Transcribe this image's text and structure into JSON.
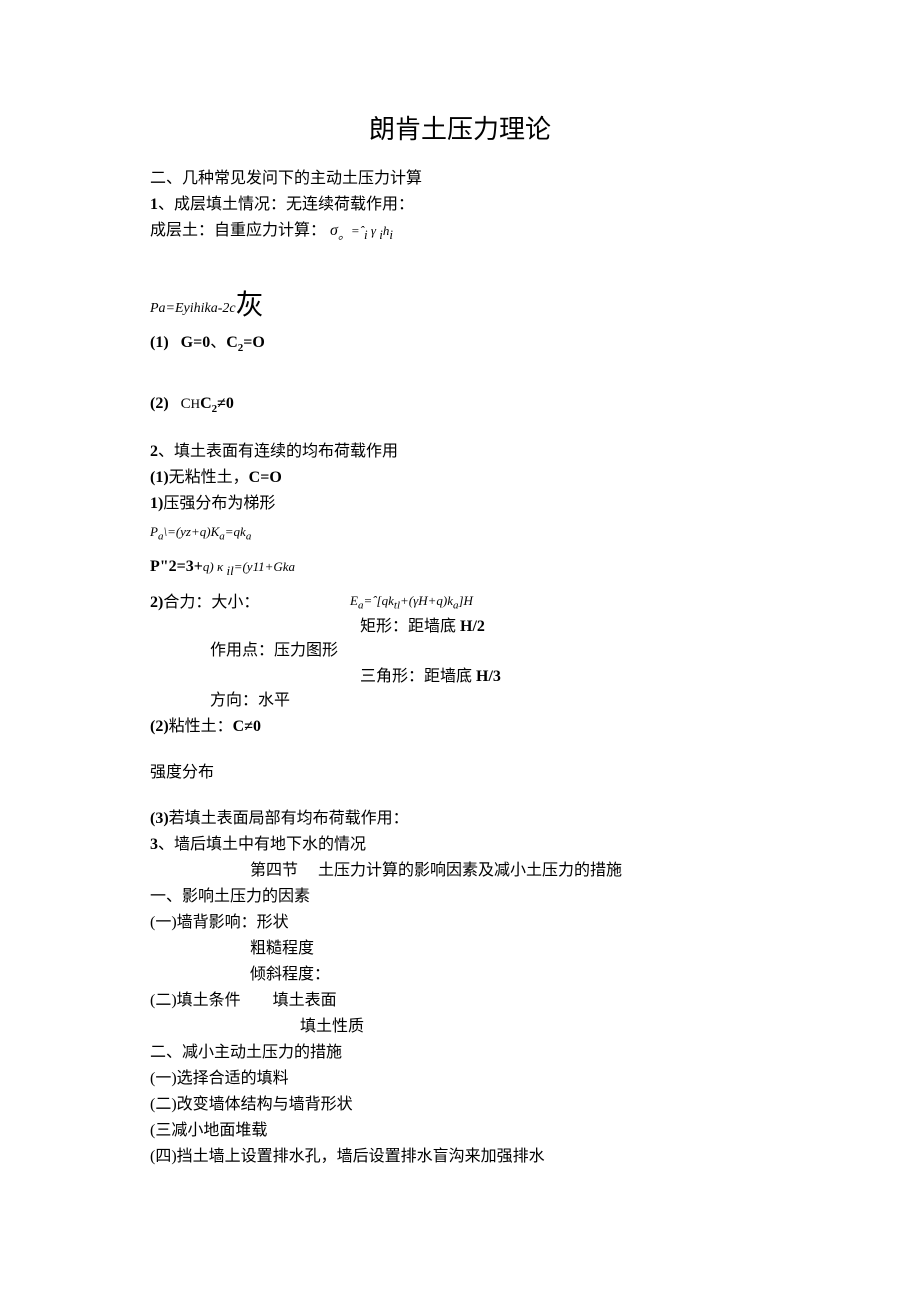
{
  "title": "朗肯土压力理论",
  "p1": "二、几种常见发问下的主动土压力计算",
  "p2a": "1",
  "p2b": "、成层填土情况：无连续荷载作用：",
  "p3a": "成层土：自重应力计算： ",
  "p3b": "σ",
  "p3c": "。",
  "p3d": "=",
  "p3e": "ˆ",
  "p3f": "i",
  "p3g": " γ ",
  "p3h": "i",
  "p3i": "h",
  "p3j": "i",
  "p4a": "Pa=Eyihika-2c",
  "p4b": "灰",
  "p5a": "(1)",
  "p5b": "G=0",
  "p5c": "、",
  "p5d": "C",
  "p5e": "2",
  "p5f": "=O",
  "p6a": "(2)",
  "p6b": "C",
  "p6c": "H",
  "p6d": "C",
  "p6e": "2",
  "p6f": "≠0",
  "p7a": "2",
  "p7b": "、填土表面有连续的均布荷载作用",
  "p8a": "(1)",
  "p8b": "无粘性土，",
  "p8c": "C=O",
  "p9a": "1)",
  "p9b": "压强分布为梯形",
  "p10a": "P",
  "p10b": "a",
  "p10c": "\\=(yz+q)K",
  "p10d": "a",
  "p10e": "=qk",
  "p10f": "a",
  "p11a": "P\"2=3+",
  "p11b": "q) κ ",
  "p11c": "il",
  "p11d": "=(y11+Gka",
  "p12a": "2)",
  "p12b": "合力：大小：",
  "p12c": "E",
  "p12d": "a",
  "p12e": "=ˆ[qk",
  "p12f": "tl",
  "p12g": "+(γH+q)k",
  "p12h": "a",
  "p12i": "]H",
  "p13": "矩形：距墙底",
  "p13b": "H/2",
  "p14": "作用点：压力图形",
  "p15": "三角形：距墙底",
  "p15b": "H/3",
  "p16": "方向：水平",
  "p17a": "(2)",
  "p17b": "粘性土：",
  "p17c": "C≠0",
  "p18": "强度分布",
  "p19a": "(3)",
  "p19b": "若填土表面局部有均布荷载作用：",
  "p20a": "3",
  "p20b": "、墙后填土中有地下水的情况",
  "p21a": "第四节",
  "p21b": "土压力计算的影响因素及减小土压力的措施",
  "p22": "一、影响土压力的因素",
  "p23": "(一)墙背影响：形状",
  "p24": "粗糙程度",
  "p25": "倾斜程度：",
  "p26a": "(二)填土条件",
  "p26b": "填土表面",
  "p27": "填土性质",
  "p28": "二、减小主动土压力的措施",
  "p29": "(一)选择合适的填料",
  "p30": "(二)改变墙体结构与墙背形状",
  "p31": "(三减小地面堆载",
  "p32": "(四)挡土墙上设置排水孔，墙后设置排水盲沟来加强排水"
}
